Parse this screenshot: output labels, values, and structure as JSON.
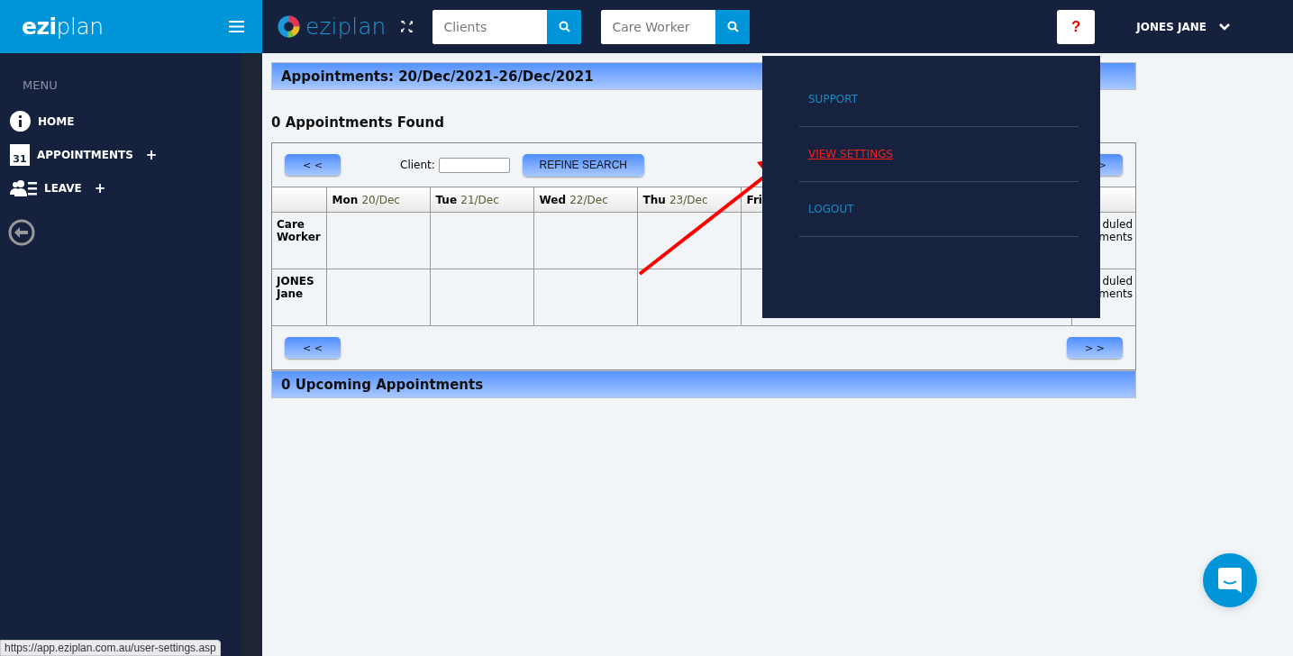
{
  "sidebar": {
    "logo": "**ezi**plan",
    "heading": "MENU",
    "items": [
      {
        "kind": "info",
        "label": "HOME"
      },
      {
        "kind": "calendar",
        "label": "APPOINTMENTS",
        "icon_text": "31",
        "expander": "+"
      },
      {
        "kind": "people",
        "label": "LEAVE",
        "expander": "+"
      }
    ]
  },
  "topbar": {
    "logo": "eziplan",
    "searches": [
      {
        "placeholder": "Clients"
      },
      {
        "placeholder": "Care Worker"
      }
    ],
    "help": "?",
    "user": "JONES JANE"
  },
  "main": {
    "title": "Appointments: 20/Dec/2021-26/Dec/2021",
    "found": "0 Appointments Found",
    "nav_top": {
      "prev": "< <",
      "client_label": "Client:",
      "refine": "REFINE SEARCH",
      "next": ">"
    },
    "columns": [
      {
        "day": "Mon",
        "date": "20/Dec"
      },
      {
        "day": "Tue",
        "date": "21/Dec"
      },
      {
        "day": "Wed",
        "date": "22/Dec"
      },
      {
        "day": "Thu",
        "date": "23/Dec"
      },
      {
        "day": "Fri"
      }
    ],
    "rows": [
      {
        "name": "Care Worker",
        "last": "duled ments"
      },
      {
        "name": "JONES Jane",
        "last": "duled ments"
      }
    ],
    "nav_bottom": {
      "prev": "< <",
      "next": "> >"
    },
    "upcoming": "0 Upcoming Appointments"
  },
  "dropdown": {
    "items": [
      {
        "label": "SUPPORT",
        "hovered": false
      },
      {
        "label": "VIEW SETTINGS",
        "hovered": true
      },
      {
        "label": "LOGOUT",
        "hovered": false
      }
    ]
  },
  "status_url": "https://app.eziplan.com.au/user-settings.asp"
}
